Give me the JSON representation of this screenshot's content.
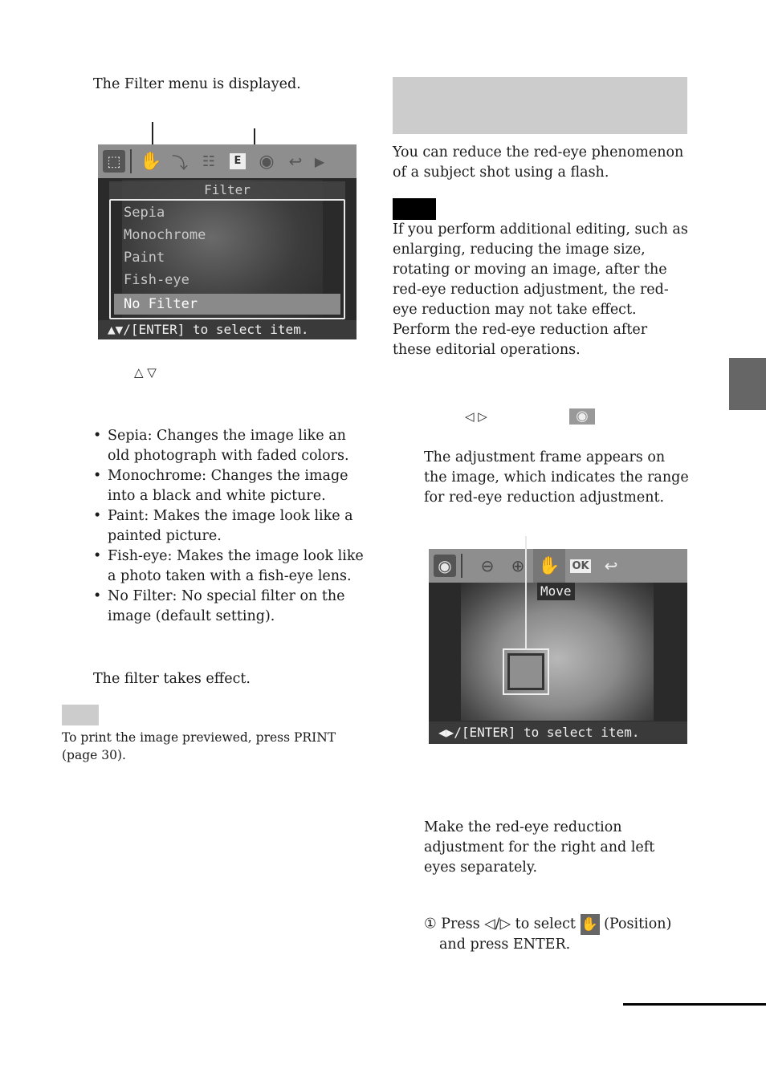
{
  "left": {
    "filter_displayed": "The Filter menu is displayed.",
    "filter_screen": {
      "toolbar_icons": [
        "select-icon",
        "hand-icon",
        "rotate-icon",
        "adjust-icon",
        "filter-effect-icon",
        "red-eye-icon",
        "undo-icon",
        "next-arrow-icon"
      ],
      "menu_title": "Filter",
      "items": [
        "Sepia",
        "Monochrome",
        "Paint",
        "Fish-eye",
        "No Filter"
      ],
      "selected_item": "No Filter",
      "hint": "▲▼/[ENTER] to select item."
    },
    "arrow_keys": "△ ▽",
    "bullets": [
      "Sepia: Changes the image like an old photograph with faded colors.",
      "Monochrome: Changes the image into a black and white picture.",
      "Paint: Makes the image look like a painted picture.",
      "Fish-eye: Makes the image look like a photo taken with a fish-eye lens.",
      "No Filter: No special filter on the image (default setting)."
    ],
    "takes_effect": "The filter takes effect.",
    "tip_text": "To print the image previewed, press PRINT (page 30)."
  },
  "right": {
    "intro": "You can reduce the red-eye phenomenon of a subject shot using a flash.",
    "note_text": "If you perform additional editing, such as enlarging, reducing the image size, rotating or moving an image, after the red-eye reduction adjustment, the red-eye reduction may not take effect.  Perform the red-eye reduction after these editorial operations.",
    "arrow_keys": "◁ ▷",
    "frame_appears": "The adjustment frame appears on the image, which indicates the range for red-eye reduction adjustment.",
    "redeye_screen": {
      "toolbar_icons": [
        "red-eye-icon",
        "zoom-out-icon",
        "zoom-in-icon",
        "hand-icon",
        "ok-icon",
        "undo-icon"
      ],
      "ok_label": "OK",
      "tooltip": "Move",
      "hint": "◀▶/[ENTER] to select item."
    },
    "separately": "Make the red-eye reduction adjustment for the right and left eyes separately.",
    "step_num": "①",
    "step_press": "Press ◁/▷ to select",
    "step_position": "(Position)",
    "step_enter": "and press ENTER."
  },
  "colors": {
    "header_band": "#cccccc",
    "side_tab": "#666666",
    "note_badge": "#000000",
    "tip_badge": "#cccccc"
  }
}
